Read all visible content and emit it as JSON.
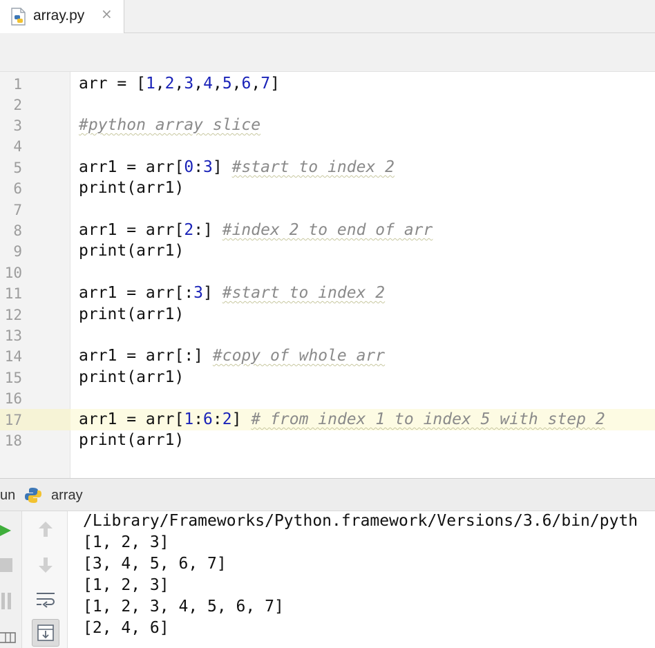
{
  "tab": {
    "label": "array.py",
    "close": "×"
  },
  "editor": {
    "line_numbers": [
      "1",
      "2",
      "3",
      "4",
      "5",
      "6",
      "7",
      "8",
      "9",
      "10",
      "11",
      "12",
      "13",
      "14",
      "15",
      "16",
      "17",
      "18"
    ],
    "lines": {
      "l1": {
        "a": "arr = [",
        "n1": "1",
        "c1": ",",
        "n2": "2",
        "c2": ",",
        "n3": "3",
        "c3": ",",
        "n4": "4",
        "c4": ",",
        "n5": "5",
        "c5": ",",
        "n6": "6",
        "c6": ",",
        "n7": "7",
        "b": "]"
      },
      "l3": {
        "comment": "#python array slice"
      },
      "l5": {
        "a": "arr1 = arr[",
        "n1": "0",
        "c1": ":",
        "n2": "3",
        "b": "] ",
        "comment": "#start to index 2"
      },
      "l6": {
        "code": "print(arr1)"
      },
      "l8": {
        "a": "arr1 = arr[",
        "n1": "2",
        "b": ":] ",
        "comment": "#index 2 to end of arr"
      },
      "l9": {
        "code": "print(arr1)"
      },
      "l11": {
        "a": "arr1 = arr[:",
        "n1": "3",
        "b": "] ",
        "comment": "#start to index 2"
      },
      "l12": {
        "code": "print(arr1)"
      },
      "l14": {
        "a": "arr1 = arr[:] ",
        "comment": "#copy of whole arr"
      },
      "l15": {
        "code": "print(arr1)"
      },
      "l17": {
        "a": "arr1 = arr[",
        "n1": "1",
        "c1": ":",
        "n2": "6",
        "c2": ":",
        "n3": "2",
        "b": "] ",
        "comment": "# from index 1 to index 5 with step 2"
      },
      "l18": {
        "code": "print(arr1)"
      }
    }
  },
  "run_panel": {
    "label": "un",
    "config": "array",
    "output": [
      "/Library/Frameworks/Python.framework/Versions/3.6/bin/pyth",
      "[1, 2, 3]",
      "[3, 4, 5, 6, 7]",
      "[1, 2, 3]",
      "[1, 2, 3, 4, 5, 6, 7]",
      "[2, 4, 6]"
    ]
  },
  "colors": {
    "number": "#1a23b8",
    "comment": "#8a8a8a",
    "current_line": "#fdfbe3",
    "run_green": "#3fae3b"
  },
  "icons": [
    "python-file-icon",
    "close-icon",
    "python-icon",
    "rerun-icon",
    "stop-icon",
    "up-arrow-icon",
    "down-arrow-icon",
    "soft-wrap-icon",
    "scroll-to-end-icon",
    "pause-icon",
    "layout-icon"
  ]
}
